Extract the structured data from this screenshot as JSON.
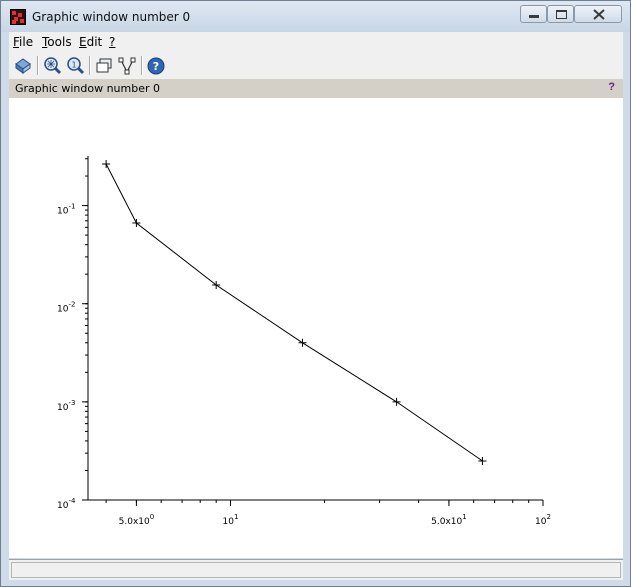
{
  "window": {
    "title": "Graphic window number 0"
  },
  "menu": {
    "items": [
      {
        "label": "File",
        "u": "F",
        "rest": "ile"
      },
      {
        "label": "Tools",
        "u": "T",
        "rest": "ools"
      },
      {
        "label": "Edit",
        "u": "E",
        "rest": "dit"
      },
      {
        "label": "?",
        "u": "?",
        "rest": ""
      }
    ]
  },
  "toolbar": {
    "icons": [
      "rotate-icon",
      "zoom-icon",
      "unzoom-icon",
      "new-window-icon",
      "datatip-icon",
      "help-icon"
    ]
  },
  "infobar": {
    "text": "Graphic window number 0",
    "help": "?"
  },
  "chart_data": {
    "type": "line",
    "marker": "+",
    "xscale": "log",
    "yscale": "log",
    "xlim": [
      3.5,
      100
    ],
    "ylim": [
      0.0001,
      0.32
    ],
    "x": [
      4,
      5,
      9,
      17,
      34,
      64
    ],
    "y": [
      0.265,
      0.0665,
      0.0155,
      0.004,
      0.001,
      0.00025
    ],
    "x_ticks": [
      {
        "value": 5,
        "mantissa": "5.0x10",
        "exp": "0"
      },
      {
        "value": 10,
        "mantissa": "10",
        "exp": "1"
      },
      {
        "value": 50,
        "mantissa": "5.0x10",
        "exp": "1"
      },
      {
        "value": 100,
        "mantissa": "10",
        "exp": "2"
      }
    ],
    "y_ticks": [
      {
        "value": 0.1,
        "mantissa": "10",
        "exp": "-1"
      },
      {
        "value": 0.01,
        "mantissa": "10",
        "exp": "-2"
      },
      {
        "value": 0.001,
        "mantissa": "10",
        "exp": "-3"
      },
      {
        "value": 0.0001,
        "mantissa": "10",
        "exp": "-4"
      }
    ]
  }
}
